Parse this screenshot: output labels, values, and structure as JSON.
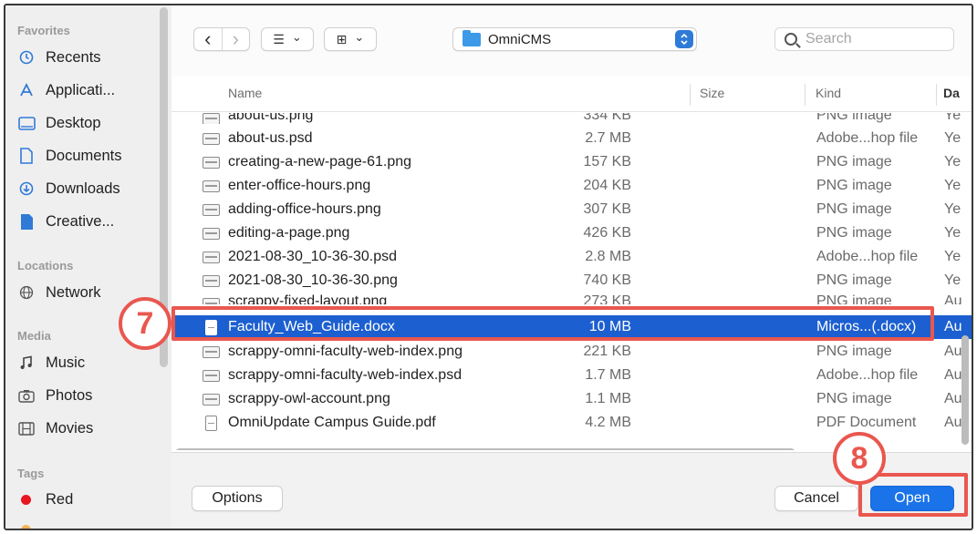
{
  "sidebar": {
    "sections": [
      {
        "heading": "Favorites"
      },
      {
        "heading": "Locations"
      },
      {
        "heading": "Media"
      },
      {
        "heading": "Tags"
      }
    ],
    "favorites": [
      {
        "label": "Recents",
        "icon": "clock-icon"
      },
      {
        "label": "Applicati...",
        "icon": "applications-icon"
      },
      {
        "label": "Desktop",
        "icon": "desktop-icon"
      },
      {
        "label": "Documents",
        "icon": "document-icon"
      },
      {
        "label": "Downloads",
        "icon": "download-icon"
      },
      {
        "label": "Creative...",
        "icon": "file-icon"
      }
    ],
    "locations": [
      {
        "label": "Network",
        "icon": "globe-icon"
      }
    ],
    "media": [
      {
        "label": "Music",
        "icon": "music-note-icon"
      },
      {
        "label": "Photos",
        "icon": "camera-icon"
      },
      {
        "label": "Movies",
        "icon": "film-icon"
      }
    ],
    "tags": [
      {
        "label": "Red",
        "color": "#e8171f"
      }
    ]
  },
  "toolbar": {
    "back_glyph": "‹",
    "forward_glyph": "›",
    "list_view_glyph": "☰",
    "grid_view_glyph": "⊞",
    "chevron_glyph": "⌄",
    "folder_name": "OmniCMS",
    "search_placeholder": "Search"
  },
  "list": {
    "columns": {
      "name": "Name",
      "size": "Size",
      "kind": "Kind",
      "date": "Da"
    },
    "rows": [
      {
        "name": "about-us.png",
        "size": "334 KB",
        "kind": "PNG image",
        "date": "Ye",
        "clipped": true
      },
      {
        "name": "about-us.psd",
        "size": "2.7 MB",
        "kind": "Adobe...hop file",
        "date": "Ye"
      },
      {
        "name": "creating-a-new-page-61.png",
        "size": "157 KB",
        "kind": "PNG image",
        "date": "Ye"
      },
      {
        "name": "enter-office-hours.png",
        "size": "204 KB",
        "kind": "PNG image",
        "date": "Ye"
      },
      {
        "name": "adding-office-hours.png",
        "size": "307 KB",
        "kind": "PNG image",
        "date": "Ye"
      },
      {
        "name": "editing-a-page.png",
        "size": "426 KB",
        "kind": "PNG image",
        "date": "Ye"
      },
      {
        "name": "2021-08-30_10-36-30.psd",
        "size": "2.8 MB",
        "kind": "Adobe...hop file",
        "date": "Ye"
      },
      {
        "name": "2021-08-30_10-36-30.png",
        "size": "740 KB",
        "kind": "PNG image",
        "date": "Ye"
      },
      {
        "name": "scrappy-fixed-layout.png",
        "size": "273 KB",
        "kind": "PNG image",
        "date": "Au",
        "clipped": true
      },
      {
        "name": "Faculty_Web_Guide.docx",
        "size": "10 MB",
        "kind": "Micros...(.docx)",
        "date": "Au",
        "selected": true
      },
      {
        "name": "scrappy-omni-faculty-web-index.png",
        "size": "221 KB",
        "kind": "PNG image",
        "date": "Au"
      },
      {
        "name": "scrappy-omni-faculty-web-index.psd",
        "size": "1.7 MB",
        "kind": "Adobe...hop file",
        "date": "Au"
      },
      {
        "name": "scrappy-owl-account.png",
        "size": "1.1 MB",
        "kind": "PNG image",
        "date": "Au"
      },
      {
        "name": "OmniUpdate Campus Guide.pdf",
        "size": "4.2 MB",
        "kind": "PDF Document",
        "date": "Au",
        "pdf": true
      }
    ]
  },
  "footer": {
    "options_label": "Options",
    "cancel_label": "Cancel",
    "open_label": "Open"
  },
  "annotations": {
    "step_select": "7",
    "step_open": "8",
    "color": "#e9574f"
  },
  "colors": {
    "selection": "#1c5fd0",
    "accent": "#1a73e8"
  }
}
